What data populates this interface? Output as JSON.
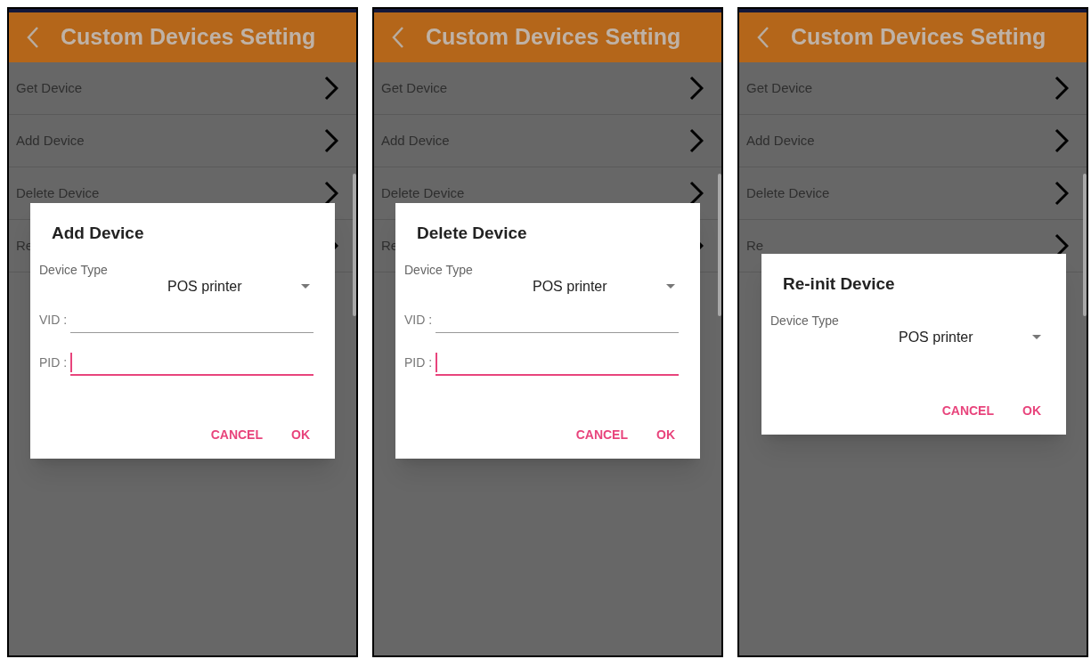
{
  "screens": [
    {
      "title": "Custom Devices Setting",
      "menu": [
        "Get Device",
        "Add Device",
        "Delete Device",
        "Re"
      ],
      "dialog": {
        "title": "Add Device",
        "device_type_label": "Device Type",
        "device_type_value": "POS printer",
        "fields": [
          {
            "label": "VID :",
            "focused": false
          },
          {
            "label": "PID :",
            "focused": true
          }
        ],
        "buttons": [
          "CANCEL",
          "OK"
        ]
      }
    },
    {
      "title": "Custom Devices Setting",
      "menu": [
        "Get Device",
        "Add Device",
        "Delete Device",
        "Re"
      ],
      "dialog": {
        "title": "Delete Device",
        "device_type_label": "Device Type",
        "device_type_value": "POS printer",
        "fields": [
          {
            "label": "VID :",
            "focused": false
          },
          {
            "label": "PID :",
            "focused": true
          }
        ],
        "buttons": [
          "CANCEL",
          "OK"
        ]
      }
    },
    {
      "title": "Custom Devices Setting",
      "menu": [
        "Get Device",
        "Add Device",
        "Delete Device",
        "Re"
      ],
      "dialog": {
        "title": "Re-init Device",
        "device_type_label": "Device Type",
        "device_type_value": "POS printer",
        "buttons": [
          "CANCEL",
          "OK"
        ]
      }
    }
  ]
}
